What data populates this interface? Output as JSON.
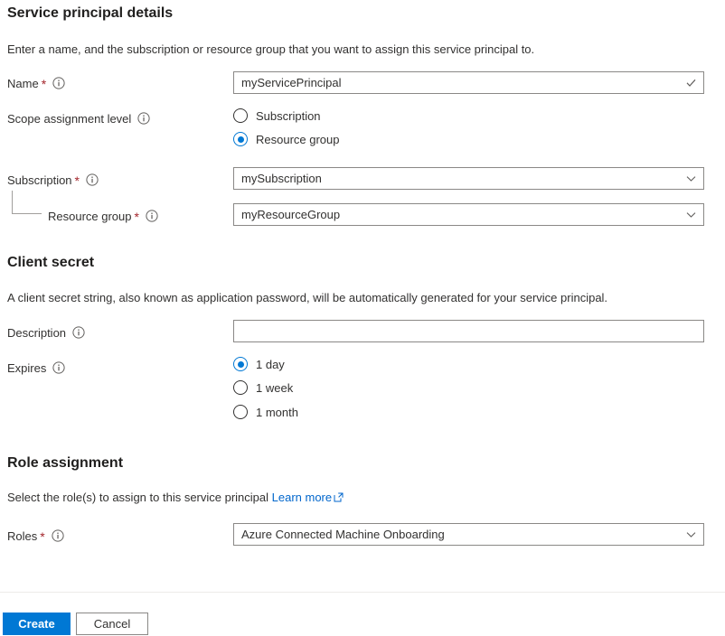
{
  "sections": {
    "service_principal": {
      "heading": "Service principal details",
      "description": "Enter a name, and the subscription or resource group that you want to assign this service principal to."
    },
    "client_secret": {
      "heading": "Client secret",
      "description": "A client secret string, also known as application password, will be automatically generated for your service principal."
    },
    "role_assignment": {
      "heading": "Role assignment",
      "description": "Select the role(s) to assign to this service principal",
      "learn_more_label": "Learn more",
      "learn_more_icon": "external-link-icon"
    }
  },
  "fields": {
    "name": {
      "label": "Name",
      "required_marker": "*",
      "info_icon": "info-icon",
      "value": "myServicePrincipal",
      "validation_icon": "checkmark-icon"
    },
    "scope_assignment_level": {
      "label": "Scope assignment level",
      "info_icon": "info-icon",
      "options": [
        {
          "label": "Subscription",
          "selected": false
        },
        {
          "label": "Resource group",
          "selected": true
        }
      ]
    },
    "subscription": {
      "label": "Subscription",
      "required_marker": "*",
      "info_icon": "info-icon",
      "value": "mySubscription",
      "dropdown_icon": "chevron-down-icon"
    },
    "resource_group": {
      "label": "Resource group",
      "required_marker": "*",
      "info_icon": "info-icon",
      "value": "myResourceGroup",
      "dropdown_icon": "chevron-down-icon"
    },
    "description": {
      "label": "Description",
      "info_icon": "info-icon",
      "value": "",
      "placeholder": ""
    },
    "expires": {
      "label": "Expires",
      "info_icon": "info-icon",
      "options": [
        {
          "label": "1 day",
          "selected": true
        },
        {
          "label": "1 week",
          "selected": false
        },
        {
          "label": "1 month",
          "selected": false
        }
      ]
    },
    "roles": {
      "label": "Roles",
      "required_marker": "*",
      "info_icon": "info-icon",
      "value": "Azure Connected Machine Onboarding",
      "dropdown_icon": "chevron-down-icon"
    }
  },
  "footer": {
    "create_label": "Create",
    "cancel_label": "Cancel"
  },
  "colors": {
    "accent": "#0078d4",
    "link": "#0066cc",
    "required": "#a4262c",
    "border": "#8a8886",
    "text": "#323130"
  }
}
